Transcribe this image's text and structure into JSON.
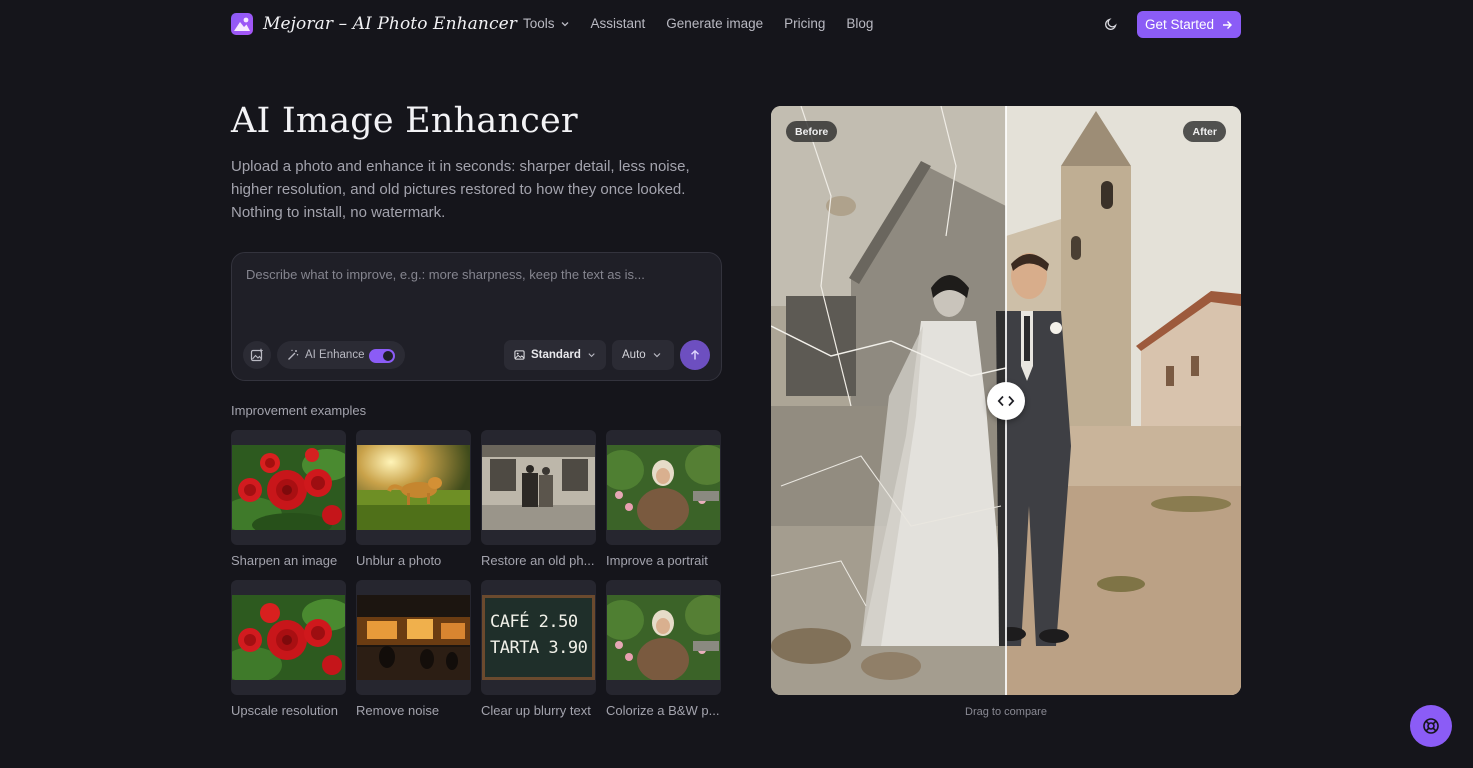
{
  "header": {
    "brand": "Mejorar – AI Photo Enhancer",
    "nav": [
      {
        "label": "Tools"
      },
      {
        "label": "Assistant"
      },
      {
        "label": "Generate image"
      },
      {
        "label": "Pricing"
      },
      {
        "label": "Blog"
      }
    ],
    "cta_label": "Get Started"
  },
  "hero": {
    "title": "AI Image Enhancer",
    "subtitle": "Upload a photo and enhance it in seconds: sharper detail, less noise, higher resolution, and old pictures restored to how they once looked. Nothing to install, no watermark."
  },
  "prompt": {
    "placeholder": "Describe what to improve, e.g.: more sharpness, keep the text as is...",
    "enhance_label": "AI Enhance",
    "enhance_on": true,
    "quality_value": "Standard",
    "mode_value": "Auto"
  },
  "examples": {
    "title": "Improvement examples",
    "items": [
      {
        "label": "Sharpen an image"
      },
      {
        "label": "Unblur a photo"
      },
      {
        "label": "Restore an old ph..."
      },
      {
        "label": "Improve a portrait"
      },
      {
        "label": "Upscale resolution"
      },
      {
        "label": "Remove noise"
      },
      {
        "label": "Clear up blurry text"
      },
      {
        "label": "Colorize a B&W p..."
      }
    ],
    "chalkboard_line1": "CAFÉ 2.50",
    "chalkboard_line2": "TARTA 3.90"
  },
  "compare": {
    "before_label": "Before",
    "after_label": "After",
    "caption": "Drag to compare"
  },
  "colors": {
    "background": "#15151b",
    "accent": "#8b5cf6",
    "panel": "#1f1f27"
  },
  "icons": [
    "image-logo-icon",
    "chevron-down-icon",
    "moon-icon",
    "arrow-right-icon",
    "image-plus-icon",
    "magic-wand-icon",
    "image-icon",
    "arrow-up-icon",
    "code-arrows-icon",
    "lifebuoy-icon"
  ]
}
